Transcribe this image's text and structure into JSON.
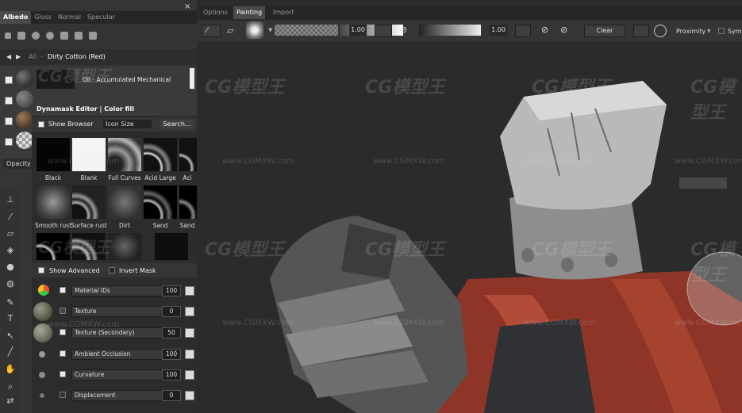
{
  "channels": {
    "tabs": [
      "Albedo",
      "Gloss",
      "Normal",
      "Specular"
    ],
    "active": "Albedo",
    "close": "×"
  },
  "library": {
    "nav_prev": "◀",
    "nav_next": "▶",
    "breadcrumb_all": "All",
    "breadcrumb_sep": "-",
    "category": "Dirty Cotton (Red)",
    "material_item": "Oil - Accumulated Mechanical",
    "opacity_label": "Opacity"
  },
  "dynamask": {
    "title": "Dynamask Editor  |  Color fill",
    "show_browser": "Show Browser",
    "icon_size": "Icon Size",
    "search": "Search...",
    "thumbnails": [
      {
        "label": "Black",
        "color": "#050505"
      },
      {
        "label": "Blank",
        "color": "#f4f4f4"
      },
      {
        "label": "Full Curves",
        "color": "#8a8a8a"
      },
      {
        "label": "Acid Large",
        "color": "#262626"
      },
      {
        "label": "Aci",
        "color": "#333333"
      },
      {
        "label": "Smooth rust",
        "color": "#6f6f6f"
      },
      {
        "label": "Surface rust",
        "color": "#4a4a4a"
      },
      {
        "label": "Dirt",
        "color": "#5a5a5a"
      },
      {
        "label": "Sand",
        "color": "#1a1a1a"
      },
      {
        "label": "Sand",
        "color": "#2a2a2a"
      }
    ],
    "show_advanced": "Show Advanced",
    "invert_mask": "Invert Mask",
    "params": [
      {
        "name": "Material IDs",
        "value": "100"
      },
      {
        "name": "Texture",
        "value": "0"
      },
      {
        "name": "Texture (Secondary)",
        "value": "50"
      },
      {
        "name": "Ambient Occlusion",
        "value": "100"
      },
      {
        "name": "Curvature",
        "value": "100"
      },
      {
        "name": "Displacement",
        "value": "0"
      }
    ]
  },
  "painting": {
    "tabs": [
      "Options",
      "Painting",
      "Import"
    ],
    "active": "Painting",
    "size_value": "1.00",
    "flow_value": "1.00",
    "clear": "Clear",
    "proximity": "Proximity",
    "sym": "Sym"
  },
  "watermarks": {
    "logo": "CG模型王",
    "url": "www.CGMXW.com"
  },
  "colors": {
    "accent": "#5a5a5a",
    "cloth_red": "#9b3a2c",
    "metal_gray": "#9a9a9a"
  }
}
